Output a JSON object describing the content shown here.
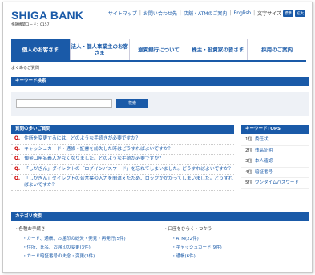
{
  "header": {
    "logo": "SHIGA BANK",
    "bank_code": "金融機関コード：0157",
    "utility_links": [
      "サイトマップ",
      "お問い合わせ先",
      "店舗・ATMのご案内",
      "English"
    ],
    "font_size_label": "文字サイズ",
    "font_size_buttons": [
      "標準",
      "拡大"
    ]
  },
  "gnav": [
    "個人のお客さま",
    "法人・個人事業主のお客さま",
    "滋賀銀行について",
    "株主・投資家の皆さま",
    "採用のご案内"
  ],
  "breadcrumb": "よくあるご質問",
  "keyword_search": {
    "heading": "キーワード検索",
    "input_value": "",
    "button": "検索"
  },
  "faq": {
    "heading": "質問の多いご質問",
    "q_mark": "Q.",
    "items": [
      "住所を変更するには、どのような手続きが必要ですか？",
      "キャッシュカード・通帳・証書を紛失した時はどうすればよいですか？",
      "預金口座名義人がなくなりました。どのような手続が必要ですか？",
      "「しがぎん」ダイレクトの「ログインパスワード」を忘れてしまいました。どうすればよいですか？",
      "「しがぎん」ダイレクトの合言葉の入力を間違えたため、ロックがかかってしまいました。どうすればよいですか？"
    ]
  },
  "keyword_tops": {
    "heading": "キーワードTOPS",
    "items": [
      {
        "rank": "1位",
        "label": "委任状"
      },
      {
        "rank": "2位",
        "label": "残高証明"
      },
      {
        "rank": "3位",
        "label": "本人確認"
      },
      {
        "rank": "4位",
        "label": "暗証番号"
      },
      {
        "rank": "5位",
        "label": "ワンタイムパスワード"
      }
    ]
  },
  "categories": {
    "heading": "カテゴリ検索",
    "left": {
      "title": "各種お手続き",
      "items": [
        "カード、通帳、お届印の紛失・発見・再発行(5件)",
        "住所、氏名、お届印の変更(3件)",
        "カード暗証番号の失念・変更(3件)"
      ]
    },
    "right": {
      "title": "口座をひらく・つかう",
      "items": [
        "ATM(22件)",
        "キャッシュカード(9件)",
        "通帳(6件)"
      ]
    }
  },
  "colors": {
    "brand": "#1a5aa8",
    "question_mark": "#cc0000",
    "search_bg": "#eef1f6"
  }
}
